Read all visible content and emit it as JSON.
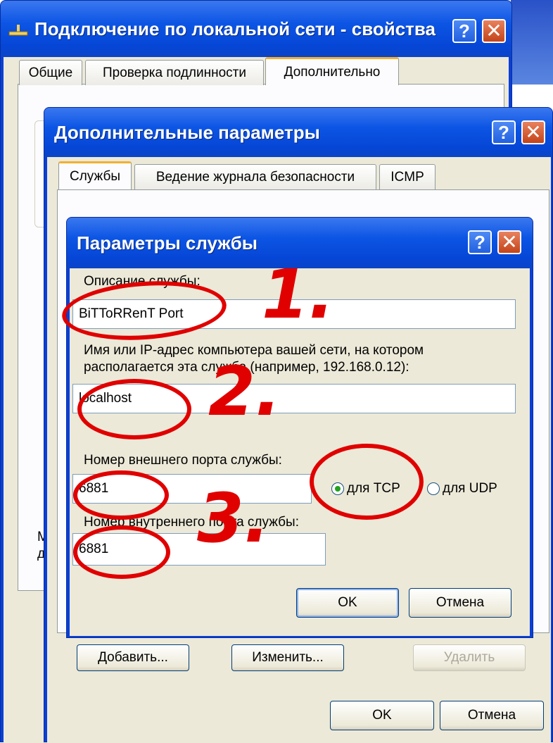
{
  "window1": {
    "title": "Подключение по локальной сети - свойства",
    "tabs": [
      "Общие",
      "Проверка подлинности",
      "Дополнительно"
    ],
    "help_glyph": "?",
    "close_glyph": "✕",
    "partial_text": "М\nд"
  },
  "window2": {
    "title": "Дополнительные параметры",
    "tabs": [
      "Службы",
      "Ведение журнала безопасности",
      "ICMP"
    ],
    "buttons": {
      "add": "Добавить...",
      "edit": "Изменить...",
      "delete": "Удалить"
    },
    "ok": "OK",
    "cancel": "Отмена"
  },
  "dialog": {
    "title": "Параметры службы",
    "service_desc_label": "Описание службы:",
    "service_desc_value": "BiTToRRenT Port",
    "host_label_line1": "Имя или IP-адрес компьютера вашей сети, на котором",
    "host_label_line2": "располагается эта служба (например, 192.168.0.12):",
    "host_value": "localhost",
    "ext_port_label": "Номер внешнего порта службы:",
    "ext_port_value": "6881",
    "tcp_label": "для TCP",
    "udp_label": "для UDP",
    "protocol_selected": "TCP",
    "int_port_label": "Номер внутреннего порта службы:",
    "int_port_value": "6881",
    "ok": "OK",
    "cancel": "Отмена"
  },
  "annotations": {
    "n1": "1.",
    "n2": "2.",
    "n3": "3.",
    "color": "#e00000"
  },
  "colors": {
    "xp_blue": "#0a3fd8",
    "dialog_face": "#ece9d8",
    "annotation_red": "#e00000"
  },
  "icons": {
    "network": "network-connection-icon"
  }
}
